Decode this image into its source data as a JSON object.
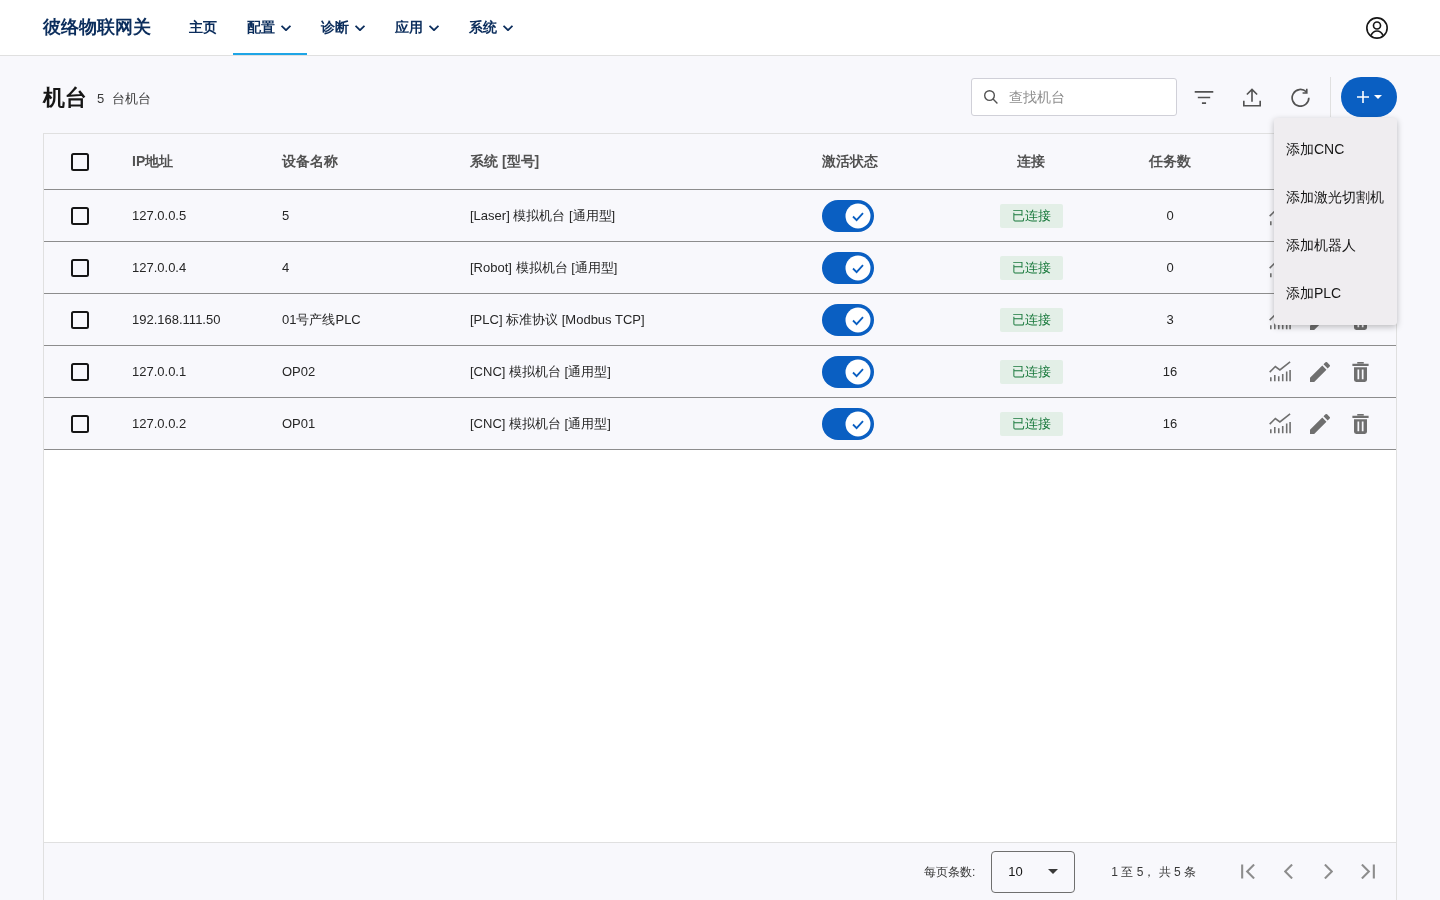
{
  "header": {
    "logo": "彼络物联网关",
    "nav": [
      {
        "label": "主页",
        "dropdown": false,
        "selected": false
      },
      {
        "label": "配置",
        "dropdown": true,
        "selected": true
      },
      {
        "label": "诊断",
        "dropdown": true,
        "selected": false
      },
      {
        "label": "应用",
        "dropdown": true,
        "selected": false
      },
      {
        "label": "系统",
        "dropdown": true,
        "selected": false
      }
    ]
  },
  "page": {
    "title": "机台",
    "count": "5",
    "count_unit": "台机台"
  },
  "toolbar": {
    "search": {
      "placeholder": "查找机台"
    },
    "add_menu": {
      "expanded": true,
      "items": [
        "添加CNC",
        "添加激光切割机",
        "添加机器人",
        "添加PLC"
      ]
    }
  },
  "table": {
    "select_all_checked": false,
    "columns": [
      "IP地址",
      "设备名称",
      "系统 [型号]",
      "激活状态",
      "连接",
      "任务数"
    ],
    "rows": [
      {
        "checked": false,
        "ip": "127.0.0.5",
        "name": "5",
        "system": "[Laser] 模拟机台 [通用型]",
        "active": true,
        "connection": {
          "label": "已连接",
          "connected": true
        },
        "tasks": "0",
        "actions": [
          {
            "kind": "chart"
          }
        ]
      },
      {
        "checked": false,
        "ip": "127.0.0.4",
        "name": "4",
        "system": "[Robot] 模拟机台 [通用型]",
        "active": true,
        "connection": {
          "label": "已连接",
          "connected": true
        },
        "tasks": "0",
        "actions": [
          {
            "kind": "chart"
          }
        ]
      },
      {
        "checked": false,
        "ip": "192.168.111.50",
        "name": "01号产线PLC",
        "system": "[PLC] 标准协议 [Modbus TCP]",
        "active": true,
        "connection": {
          "label": "已连接",
          "connected": true
        },
        "tasks": "3",
        "actions": [
          {
            "kind": "chart"
          },
          {
            "kind": "edit"
          },
          {
            "kind": "delete"
          }
        ]
      },
      {
        "checked": false,
        "ip": "127.0.0.1",
        "name": "OP02",
        "system": "[CNC] 模拟机台 [通用型]",
        "active": true,
        "connection": {
          "label": "已连接",
          "connected": true
        },
        "tasks": "16",
        "actions": [
          {
            "kind": "chart"
          },
          {
            "kind": "edit"
          },
          {
            "kind": "delete"
          }
        ]
      },
      {
        "checked": false,
        "ip": "127.0.0.2",
        "name": "OP01",
        "system": "[CNC] 模拟机台 [通用型]",
        "active": true,
        "connection": {
          "label": "已连接",
          "connected": true
        },
        "tasks": "16",
        "actions": [
          {
            "kind": "chart"
          },
          {
            "kind": "edit"
          },
          {
            "kind": "delete"
          }
        ]
      }
    ]
  },
  "pagination": {
    "page_size_label": "每页条数:",
    "page_size": "10",
    "range": "1 至 5， 共 5 条",
    "buttons": [
      {
        "kind": "first",
        "disabled": true
      },
      {
        "kind": "prev",
        "disabled": true
      },
      {
        "kind": "next",
        "disabled": true
      },
      {
        "kind": "last",
        "disabled": true
      }
    ]
  }
}
